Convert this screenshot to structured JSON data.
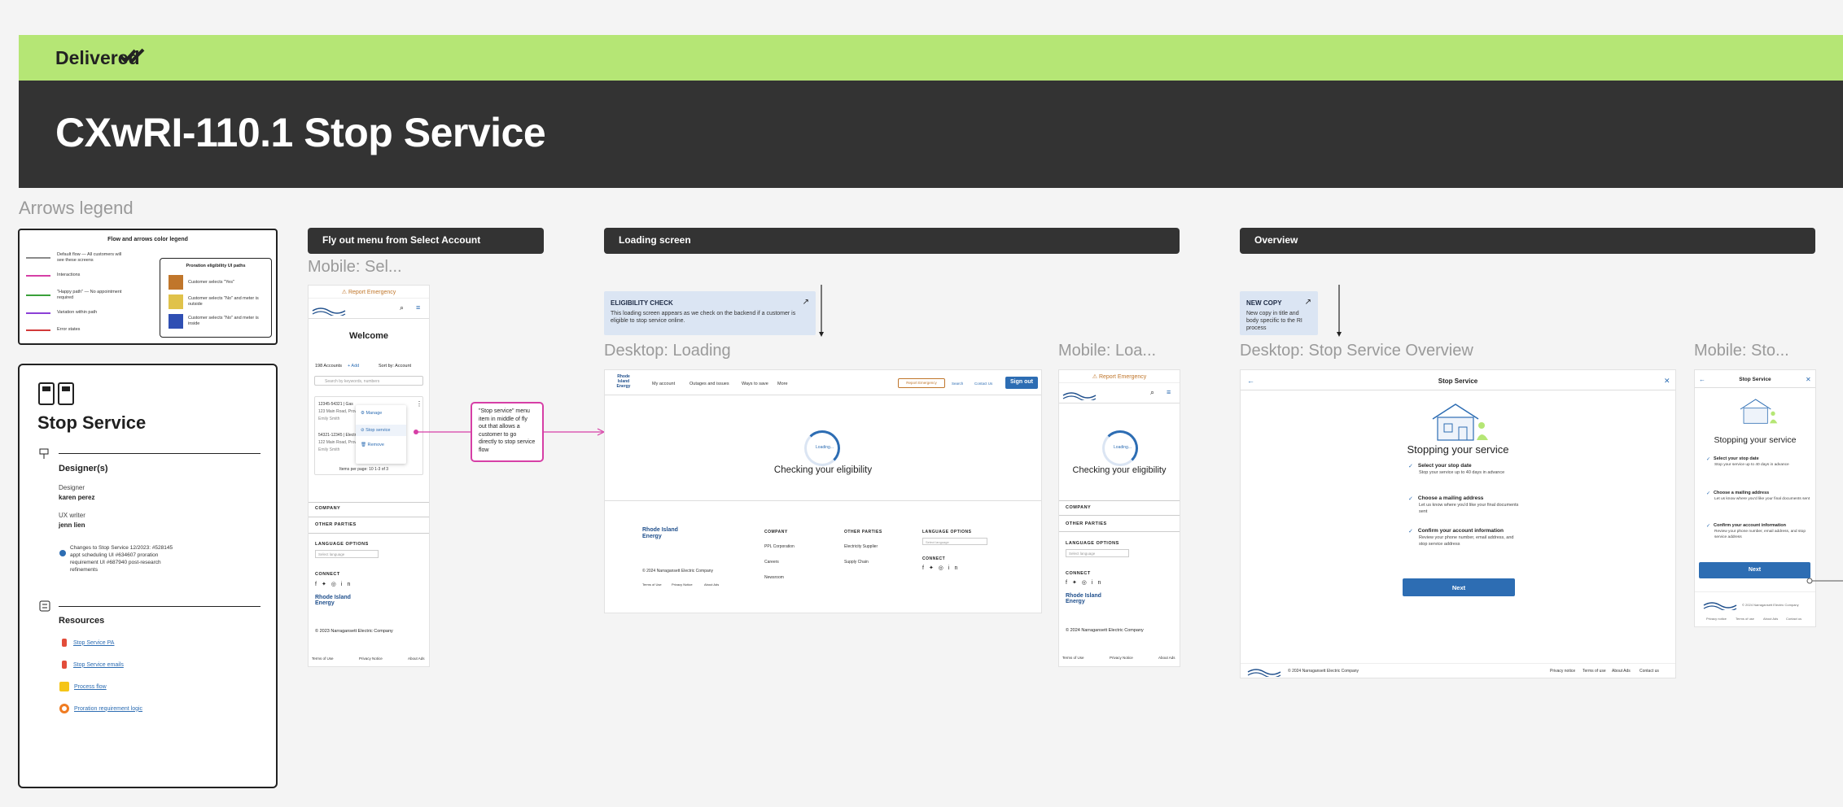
{
  "header": {
    "status": "Delivered",
    "status_icon": "double-check-icon",
    "title": "CXwRI-110.1 Stop Service",
    "status_color": "#b5e675"
  },
  "legend": {
    "label": "Arrows legend",
    "card_title": "Flow and arrows color legend",
    "items": [
      {
        "color": "#8a8a8a",
        "text": "Default flow — All customers will see these screens"
      },
      {
        "color": "#d63fa6",
        "text": "Interactions"
      },
      {
        "color": "#3aa03a",
        "text": "\"Happy path\" — No appointment required"
      },
      {
        "color": "#8b3fd6",
        "text": "Variation within path"
      },
      {
        "color": "#d23a3a",
        "text": "Error states"
      }
    ],
    "proration": {
      "title": "Proration eligibility UI paths",
      "items": [
        {
          "color": "#c0762b",
          "text": "Customer selects \"Yes\""
        },
        {
          "color": "#e0c24a",
          "text": "Customer selects \"No\" and meter is outside"
        },
        {
          "color": "#2f4fb3",
          "text": "Customer selects \"No\" and meter is inside"
        }
      ]
    }
  },
  "info": {
    "title": "Stop Service",
    "designers_heading": "Designer(s)",
    "designer_role": "Designer",
    "designer_name": "karen perez",
    "writer_role": "UX writer",
    "writer_name": "jenn lien",
    "changes": "Changes to Stop Service 12/2023: #528145 appt scheduling UI #634607 proration requirement UI #687940 post-research refinements",
    "resources_heading": "Resources",
    "resources": [
      "Stop Service PA",
      "Stop Service emails",
      "Process flow",
      "Proration requirement logic"
    ]
  },
  "sections": {
    "flyout": "Fly out menu from Select Account",
    "loading": "Loading screen",
    "overview": "Overview"
  },
  "frames": {
    "mobile_select": "Mobile: Sel...",
    "desktop_loading": "Desktop: Loading",
    "mobile_loading": "Mobile: Loa...",
    "desktop_overview": "Desktop: Stop Service Overview",
    "mobile_overview": "Mobile: Sto..."
  },
  "notes": {
    "eligibility_title": "ELIGIBILITY CHECK",
    "eligibility_text": "This loading screen appears as we check on the backend if a customer is eligible to stop service online.",
    "newcopy_title": "NEW COPY",
    "newcopy_text": "New copy in title and body specific to the RI process",
    "flyout_callout": "\"Stop service\" menu item in middle of fly out that allows a customer to go directly to stop service flow"
  },
  "mobile_select": {
    "report": "Report Emergency",
    "welcome": "Welcome",
    "accounts": "198 Accounts",
    "add": "+ Add",
    "sort": "Sort by: Account",
    "search_placeholder": "Search by keywords, numbers",
    "acct1": "12345-54321 | Gas",
    "acct1_addr": "123 Main Road, Provi...",
    "acct1_name": "Emily Smith",
    "acct2": "54321-12345 | Electr...",
    "acct2_addr": "122 Main Road, Provi...",
    "acct2_name": "Emily Smith",
    "menu": [
      "Manage",
      "Stop service",
      "Remove"
    ],
    "pager": "Items per page: 10   1-3 of 3",
    "company": "COMPANY",
    "other_parties": "OTHER PARTIES",
    "language": "LANGUAGE OPTIONS",
    "select_language": "Select language",
    "connect": "CONNECT",
    "brand": "Rhode Island Energy",
    "copyright": "© 2023 Narragansett Electric Company",
    "legal": [
      "Terms of Use",
      "Privacy Notice",
      "About Ads"
    ]
  },
  "desktop_loading": {
    "brand": "Rhode Island Energy",
    "nav": [
      "My account",
      "Outages and issues",
      "Ways to save",
      "More"
    ],
    "report": "Report Emergency",
    "search": "Search",
    "contact": "Contact Us",
    "signout": "Sign out",
    "loading": "Loading...",
    "checking": "Checking your eligibility",
    "company": "COMPANY",
    "company_links": [
      "PPL Corporation",
      "Careers",
      "Newsroom"
    ],
    "other": "OTHER PARTIES",
    "other_links": [
      "Electricity Supplier",
      "Supply Chain"
    ],
    "language": "LANGUAGE OPTIONS",
    "select_language": "Select language",
    "connect": "CONNECT",
    "copyright": "© 2024 Narragansett Electric Company",
    "legal": [
      "Terms of Use",
      "Privacy Notice",
      "About Ads"
    ]
  },
  "mobile_loading": {
    "report": "Report Emergency",
    "loading": "Loading...",
    "checking": "Checking your eligibility",
    "company": "COMPANY",
    "other": "OTHER PARTIES",
    "language": "LANGUAGE OPTIONS",
    "select_language": "Select language",
    "connect": "CONNECT",
    "brand": "Rhode Island Energy",
    "copyright": "© 2024 Narragansett Electric Company",
    "legal": [
      "Terms of Use",
      "Privacy Notice",
      "About Ads"
    ]
  },
  "overview": {
    "header": "Stop Service",
    "heading": "Stopping your service",
    "steps": [
      {
        "title": "Select your stop date",
        "text": "Stop your service up to 40 days in advance"
      },
      {
        "title": "Choose a mailing address",
        "text": "Let us know where you'd like your final documents sent"
      },
      {
        "title": "Confirm your account information",
        "text": "Review your phone number, email address, and stop service address"
      }
    ],
    "next": "Next",
    "copyright": "© 2024 Narragansett Electric Company",
    "legal": [
      "Privacy notice",
      "Terms of use",
      "About Ads",
      "Contact us"
    ]
  }
}
